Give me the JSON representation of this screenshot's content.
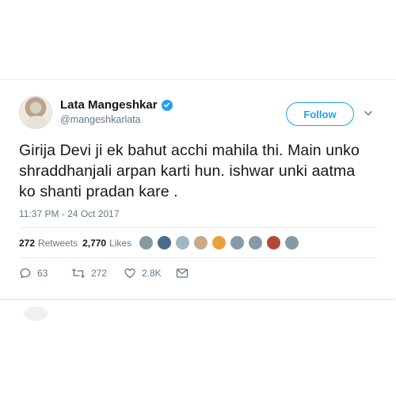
{
  "tweet": {
    "display_name": "Lata Mangeshkar",
    "handle": "@mangeshkarlata",
    "verified": true,
    "follow_label": "Follow",
    "text": "Girija Devi ji ek bahut acchi mahila thi. Main unko shraddhanjali arpan karti hun. ishwar unki aatma ko shanti pradan kare .",
    "timestamp": "11:37 PM - 24 Oct 2017",
    "stats": {
      "retweets_count": "272",
      "retweets_label": "Retweets",
      "likes_count": "2,770",
      "likes_label": "Likes"
    },
    "actions": {
      "replies": "63",
      "retweets": "272",
      "likes": "2.8K"
    }
  },
  "colors": {
    "accent": "#1da1f2",
    "secondary_text": "#657786",
    "divider": "#e6ecf0"
  }
}
